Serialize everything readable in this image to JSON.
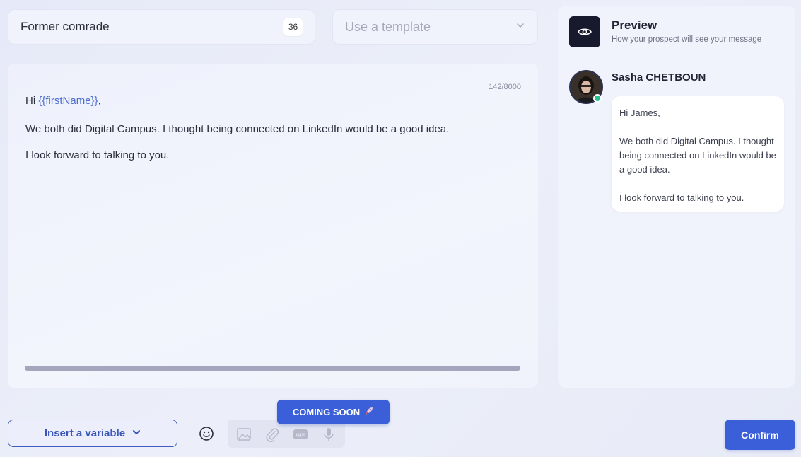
{
  "message_name": {
    "value": "Former comrade",
    "count": "36"
  },
  "template": {
    "placeholder": "Use a template",
    "chevron_icon": "chevron-down-icon"
  },
  "editor": {
    "char_count": "142/8000",
    "greeting_prefix": "Hi ",
    "greeting_variable": "{{firstName}}",
    "greeting_suffix": ",",
    "line2": "We both did Digital Campus. I thought being connected on LinkedIn would be a good idea.",
    "line3": "I look forward to talking to you."
  },
  "preview": {
    "icon": "eye-icon",
    "title": "Preview",
    "subtitle": "How your prospect will see your message",
    "sender_name": "Sasha CHETBOUN",
    "online_status_color": "#22c48e",
    "bubble": {
      "greeting": "Hi James,",
      "body": "We both did Digital Campus. I thought being connected on LinkedIn would be a good idea.",
      "closing": "I look forward to talking to you."
    }
  },
  "toolbar": {
    "insert_variable_label": "Insert a variable",
    "coming_soon_label": "COMING SOON",
    "coming_soon_icon": "rocket-icon",
    "confirm_label": "Confirm",
    "icons": [
      "emoji-icon",
      "image-icon",
      "paperclip-icon",
      "gif-icon",
      "microphone-icon"
    ]
  },
  "colors": {
    "accent": "#3a5fd9",
    "variable_text": "#4a6ed1",
    "dark_icon_bg": "#171a2c"
  }
}
